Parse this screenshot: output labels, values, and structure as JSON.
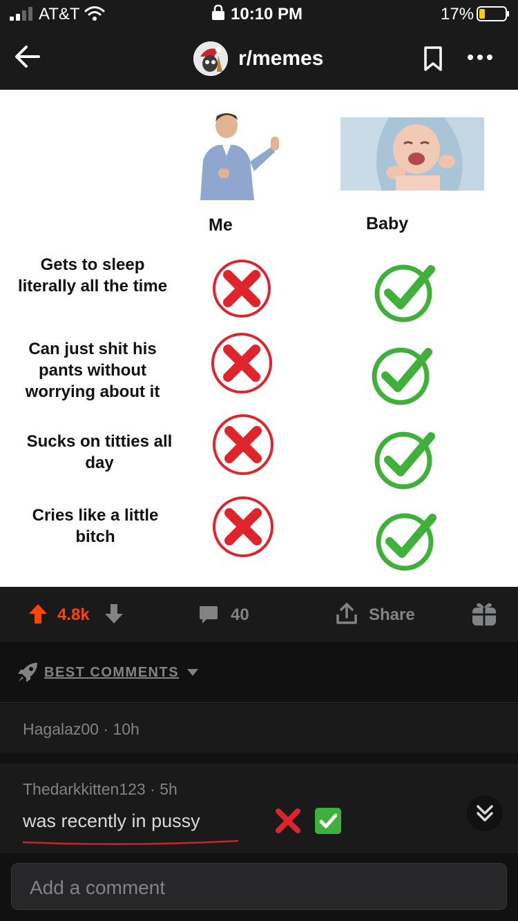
{
  "status_bar": {
    "carrier": "AT&T",
    "time": "10:10 PM",
    "battery_percent": "17%",
    "icons": [
      "signal-icon",
      "wifi-icon",
      "lock-icon",
      "battery-icon"
    ]
  },
  "header": {
    "subreddit": "r/memes",
    "icons": [
      "back-arrow-icon",
      "subreddit-avatar",
      "bookmark-icon",
      "more-options-icon"
    ]
  },
  "meme": {
    "columns": [
      "Me",
      "Baby"
    ],
    "rows": [
      {
        "label": "Gets to sleep literally all the time",
        "me": "cross",
        "baby": "check"
      },
      {
        "label": "Can just shit his pants without worrying about it",
        "me": "cross",
        "baby": "check"
      },
      {
        "label": "Sucks on titties all day",
        "me": "cross",
        "baby": "check"
      },
      {
        "label": "Cries like a little bitch",
        "me": "cross",
        "baby": "check"
      }
    ],
    "colors": {
      "cross": "#e0242b",
      "check": "#3fb13b"
    }
  },
  "actions": {
    "score": "4.8k",
    "comment_count": "40",
    "share_label": "Share",
    "score_color": "#ff4500"
  },
  "sort": {
    "label": "BEST COMMENTS"
  },
  "comments": [
    {
      "author": "Hagalaz00",
      "age": "10h"
    },
    {
      "author": "Thedarkkitten123",
      "age": "5h",
      "body": "was recently in pussy",
      "emojis": [
        "cross-mark-emoji",
        "check-mark-emoji"
      ]
    }
  ],
  "comment_input": {
    "placeholder": "Add a comment"
  }
}
